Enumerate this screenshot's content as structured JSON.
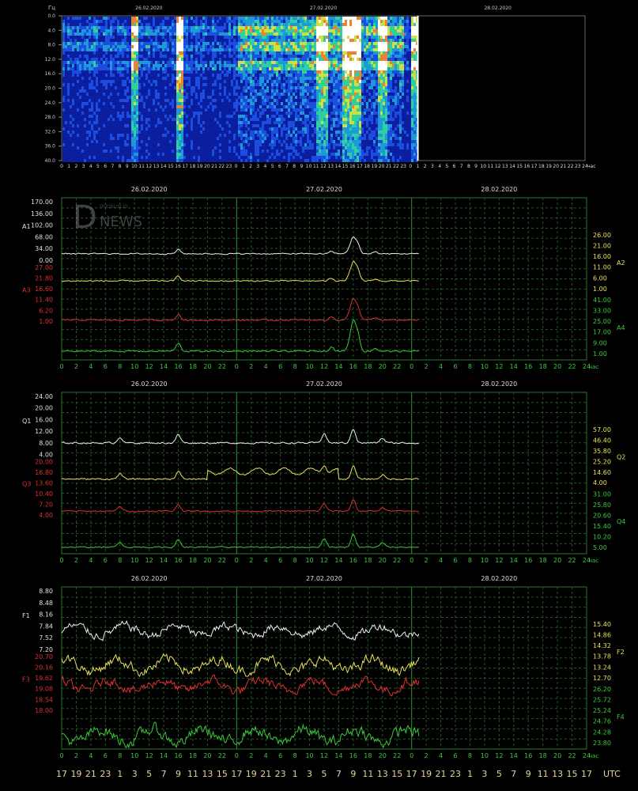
{
  "spectrogram": {
    "freq_unit": "Гц",
    "freq_ticks": [
      "0.0",
      "4.0",
      "8.0",
      "12.0",
      "16.0",
      "20.0",
      "24.0",
      "28.0",
      "32.0",
      "36.0",
      "40.0"
    ],
    "dates": [
      "26.02.2020",
      "27.02.2020",
      "28.02.2020"
    ],
    "hour_ticks": [
      "0",
      "1",
      "2",
      "3",
      "4",
      "5",
      "6",
      "7",
      "8",
      "9",
      "10",
      "11",
      "12",
      "13",
      "14",
      "15",
      "16",
      "17",
      "18",
      "19",
      "20",
      "21",
      "22",
      "23",
      "0",
      "1",
      "2",
      "3",
      "4",
      "5",
      "6",
      "7",
      "8",
      "9",
      "10",
      "11",
      "12",
      "13",
      "14",
      "15",
      "16",
      "17",
      "18",
      "19",
      "20",
      "21",
      "22",
      "23",
      "0",
      "1",
      "2",
      "3",
      "4",
      "5",
      "6",
      "7",
      "8",
      "9",
      "10",
      "11",
      "12",
      "13",
      "14",
      "15",
      "16",
      "17",
      "18",
      "19",
      "20",
      "21",
      "22",
      "23",
      "24"
    ],
    "hour_unit": "час",
    "data_until_hour": 49
  },
  "panel_common": {
    "dates": [
      "26.02.2020",
      "27.02.2020",
      "28.02.2020"
    ],
    "hour_ticks": [
      "0",
      "2",
      "4",
      "6",
      "8",
      "10",
      "12",
      "14",
      "16",
      "18",
      "20",
      "22",
      "0",
      "2",
      "4",
      "6",
      "8",
      "10",
      "12",
      "14",
      "16",
      "18",
      "20",
      "22",
      "0",
      "2",
      "4",
      "6",
      "8",
      "10",
      "12",
      "14",
      "16",
      "18",
      "20",
      "22",
      "24"
    ],
    "hour_unit": "час"
  },
  "watermark": {
    "letter": "D",
    "word": "NEWS",
    "small": "DUOBUSLID"
  },
  "chart_data": [
    {
      "type": "line",
      "title": "A",
      "series": [
        {
          "name": "A1",
          "side": "left",
          "color": "#f0f0f0",
          "ticks": [
            "170.00",
            "136.00",
            "102.00",
            "68.00",
            "34.00",
            "0.00"
          ]
        },
        {
          "name": "A2",
          "side": "right",
          "color": "#e8e05a",
          "ticks": [
            "26.00",
            "21.00",
            "16.00",
            "11.00",
            "6.00",
            "1.00"
          ]
        },
        {
          "name": "A3",
          "side": "left",
          "color": "#e03030",
          "ticks": [
            "27.00",
            "21.80",
            "16.60",
            "11.40",
            "6.20",
            "1.00"
          ]
        },
        {
          "name": "A4",
          "side": "right",
          "color": "#3cc83c",
          "ticks": [
            "41.00",
            "33.00",
            "25.00",
            "17.00",
            "9.00",
            "1.00"
          ]
        }
      ],
      "xlim_hours": [
        0,
        72
      ]
    },
    {
      "type": "line",
      "title": "Q",
      "series": [
        {
          "name": "Q1",
          "side": "left",
          "color": "#f0f0f0",
          "ticks": [
            "24.00",
            "20.00",
            "16.00",
            "12.00",
            "8.00",
            "4.00"
          ]
        },
        {
          "name": "Q2",
          "side": "right",
          "color": "#e8e05a",
          "ticks": [
            "57.00",
            "46.40",
            "35.80",
            "25.20",
            "14.60",
            "4.00"
          ]
        },
        {
          "name": "Q3",
          "side": "left",
          "color": "#e03030",
          "ticks": [
            "20.00",
            "16.80",
            "13.60",
            "10.40",
            "7.20",
            "4.00"
          ]
        },
        {
          "name": "Q4",
          "side": "right",
          "color": "#3cc83c",
          "ticks": [
            "31.00",
            "25.80",
            "20.60",
            "15.40",
            "10.20",
            "5.00"
          ]
        }
      ],
      "xlim_hours": [
        0,
        72
      ]
    },
    {
      "type": "line",
      "title": "F",
      "series": [
        {
          "name": "F1",
          "side": "left",
          "color": "#f0f0f0",
          "ticks": [
            "8.80",
            "8.48",
            "8.16",
            "7.84",
            "7.52",
            "7.20"
          ]
        },
        {
          "name": "F2",
          "side": "right",
          "color": "#e8e05a",
          "ticks": [
            "15.40",
            "14.86",
            "14.32",
            "13.78",
            "13.24",
            "12.70"
          ]
        },
        {
          "name": "F3",
          "side": "left",
          "color": "#e03030",
          "ticks": [
            "20.70",
            "20.16",
            "19.62",
            "19.08",
            "18.54",
            "18.00"
          ]
        },
        {
          "name": "F4",
          "side": "right",
          "color": "#3cc83c",
          "ticks": [
            "26.20",
            "25.72",
            "25.24",
            "24.76",
            "24.28",
            "23.80"
          ]
        }
      ],
      "xlim_hours": [
        0,
        72
      ]
    }
  ],
  "utc_axis": {
    "labels": [
      "17",
      "19",
      "21",
      "23",
      "1",
      "3",
      "5",
      "7",
      "9",
      "11",
      "13",
      "15",
      "17",
      "19",
      "21",
      "23",
      "1",
      "3",
      "5",
      "7",
      "9",
      "11",
      "13",
      "15",
      "17",
      "19",
      "21",
      "23",
      "1",
      "3",
      "5",
      "7",
      "9",
      "11",
      "13",
      "15",
      "17"
    ],
    "unit": "UTC"
  }
}
